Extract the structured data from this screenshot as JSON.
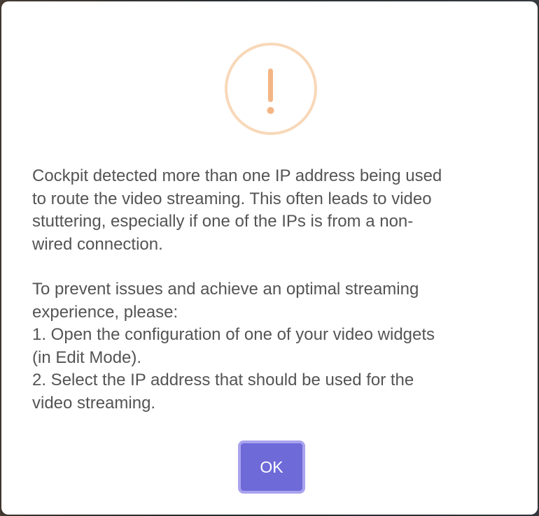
{
  "dialog": {
    "icon": "warning-exclamation-icon",
    "accent_color": "#f8bb86",
    "paragraph1": [
      "Cockpit detected more than one IP address being used",
      "to route the video streaming. This often leads to video",
      "stuttering, especially if one of the IPs is from a non-",
      "wired connection."
    ],
    "paragraph2": [
      "To prevent issues and achieve an optimal streaming",
      "experience, please:",
      "1. Open the configuration of one of your video widgets",
      "(in Edit Mode).",
      "2. Select the IP address that should be used for the",
      "video streaming."
    ],
    "ok_label": "OK",
    "ok_color": "#6e6ad8"
  }
}
